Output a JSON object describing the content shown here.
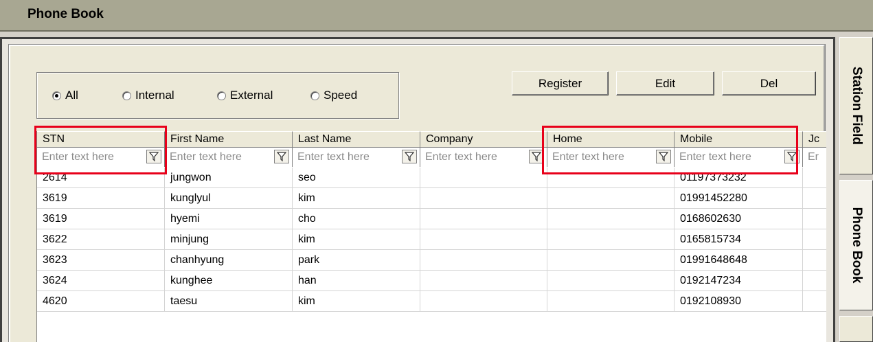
{
  "window": {
    "title": "Phone Book"
  },
  "filter_group": {
    "options": [
      {
        "label": "All",
        "selected": true
      },
      {
        "label": "Internal",
        "selected": false
      },
      {
        "label": "External",
        "selected": false
      },
      {
        "label": "Speed",
        "selected": false
      }
    ]
  },
  "toolbar": {
    "register_label": "Register",
    "edit_label": "Edit",
    "del_label": "Del"
  },
  "grid": {
    "columns": [
      "STN",
      "First Name",
      "Last Name",
      "Company",
      "Home",
      "Mobile",
      "Jc"
    ],
    "filter_placeholder": "Enter text here",
    "filter_placeholder_truncated": "Er",
    "rows": [
      [
        "2614",
        "jungwon",
        "seo",
        "",
        "",
        "01197373232"
      ],
      [
        "3619",
        "kunglyul",
        "kim",
        "",
        "",
        "01991452280"
      ],
      [
        "3619",
        "hyemi",
        "cho",
        "",
        "",
        "0168602630"
      ],
      [
        "3622",
        "minjung",
        "kim",
        "",
        "",
        "0165815734"
      ],
      [
        "3623",
        "chanhyung",
        "park",
        "",
        "",
        "01991648648"
      ],
      [
        "3624",
        "kunghee",
        "han",
        "",
        "",
        "0192147234"
      ],
      [
        "4620",
        "taesu",
        "kim",
        "",
        "",
        "0192108930"
      ]
    ]
  },
  "side_tabs": [
    "Station Field",
    "Phone Book"
  ],
  "colors": {
    "highlight": "#e8001a",
    "title_bar": "#a8a792",
    "face": "#ece9d8"
  }
}
